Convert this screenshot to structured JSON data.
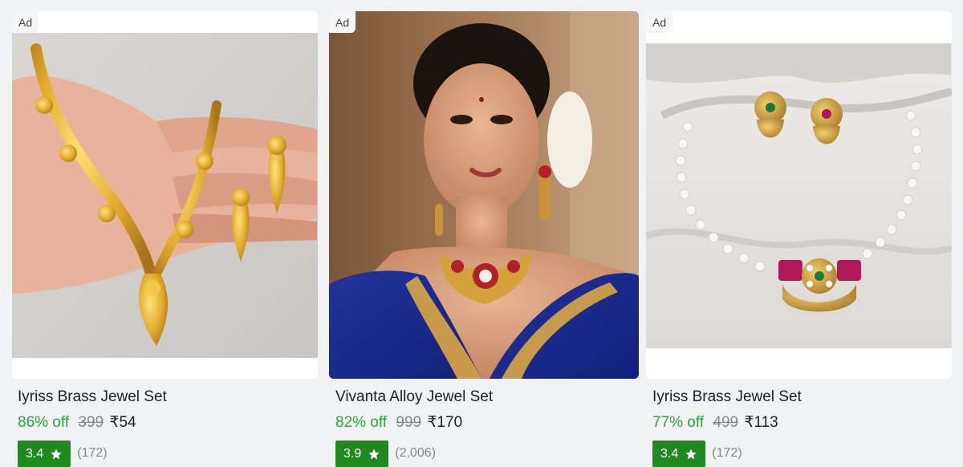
{
  "products": [
    {
      "ad_label": "Ad",
      "title": "Iyriss Brass Jewel Set",
      "discount": "86% off",
      "mrp": "399",
      "price": "₹54",
      "rating": "3.4",
      "rating_count": "(172)",
      "image_icon": "gold-leaf-necklace-set-image"
    },
    {
      "ad_label": "Ad",
      "title": "Vivanta Alloy Jewel Set",
      "discount": "82% off",
      "mrp": "999",
      "price": "₹170",
      "rating": "3.9",
      "rating_count": "(2,006)",
      "image_icon": "model-wearing-choker-set-image"
    },
    {
      "ad_label": "Ad",
      "title": "Iyriss Brass Jewel Set",
      "discount": "77% off",
      "mrp": "499",
      "price": "₹113",
      "rating": "3.4",
      "rating_count": "(172)",
      "image_icon": "pearl-pendant-necklace-set-image"
    }
  ],
  "colors": {
    "discount_green": "#26a541",
    "rating_green": "#1f8a1f",
    "muted_gray": "#878787",
    "page_background": "#f1f2f4"
  }
}
